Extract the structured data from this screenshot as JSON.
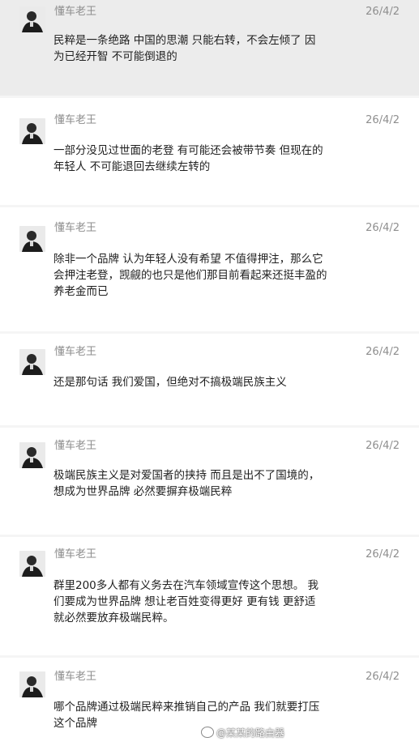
{
  "messages": [
    {
      "name": "懂车老王",
      "date": "26/4/2",
      "lines": [
        "民粹是一条绝路  中国的思潮 只能右转，不会左倾了 因",
        "为已经开智 不可能倒退的"
      ]
    },
    {
      "name": "懂车老王",
      "date": "26/4/2",
      "lines": [
        "一部分没见过世面的老登 有可能还会被带节奏 但现在的",
        "年轻人 不可能退回去继续左转的"
      ]
    },
    {
      "name": "懂车老王",
      "date": "26/4/2",
      "lines": [
        "除非一个品牌 认为年轻人没有希望 不值得押注，那么它",
        "会押注老登，觊觎的也只是他们那目前看起来还挺丰盈的",
        "养老金而已"
      ]
    },
    {
      "name": "懂车老王",
      "date": "26/4/2",
      "lines": [
        "还是那句话 我们爱国，但绝对不搞极端民族主义"
      ]
    },
    {
      "name": "懂车老王",
      "date": "26/4/2",
      "lines": [
        "极端民族主义是对爱国者的挟持 而且是出不了国境的，",
        "想成为世界品牌 必然要摒弃极端民粹"
      ]
    },
    {
      "name": "懂车老王",
      "date": "26/4/2",
      "lines": [
        "群里200多人都有义务去在汽车领域宣传这个思想。 我",
        "们要成为世界品牌 想让老百姓变得更好 更有钱 更舒适",
        "就必然要放弃极端民粹。"
      ]
    },
    {
      "name": "懂车老王",
      "date": "26/4/2",
      "lines": [
        "哪个品牌通过极端民粹来推销自己的产品 我们就要打压",
        "这个品牌"
      ]
    }
  ],
  "watermark": "@某某的路由器"
}
